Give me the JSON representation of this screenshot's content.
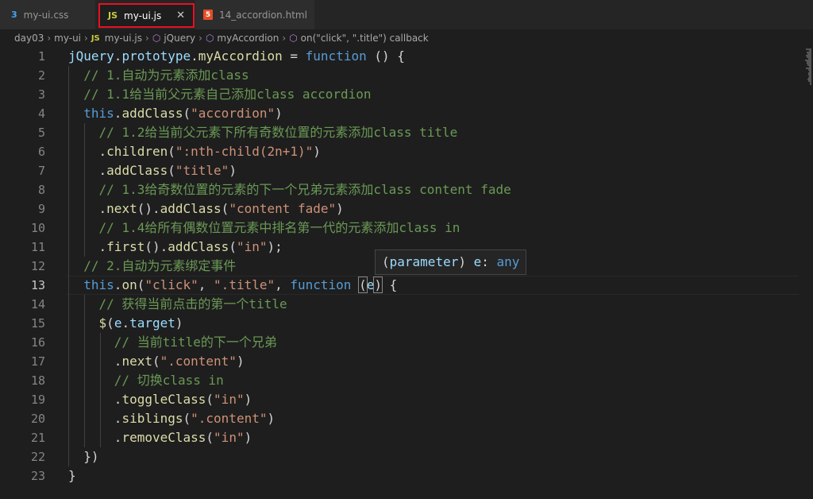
{
  "tabs": [
    {
      "label": "my-ui.css",
      "icon": "css-file-icon",
      "glyph": "3"
    },
    {
      "label": "my-ui.js",
      "icon": "js-file-icon",
      "glyph": "JS",
      "close": "✕"
    },
    {
      "label": "14_accordion.html",
      "icon": "html-file-icon",
      "glyph": "5"
    }
  ],
  "breadcrumb": [
    "day03",
    "my-ui",
    "my-ui.js",
    "jQuery",
    "myAccordion",
    "on(\"click\", \".title\") callback"
  ],
  "breadcrumb_js_glyph": "JS",
  "hover": {
    "text": "(parameter) e: any"
  },
  "current_line": 13,
  "line_numbers": [
    "1",
    "2",
    "3",
    "4",
    "5",
    "6",
    "7",
    "8",
    "9",
    "10",
    "11",
    "12",
    "13",
    "14",
    "15",
    "16",
    "17",
    "18",
    "19",
    "20",
    "21",
    "22",
    "23"
  ],
  "code_lines": [
    "jQuery.prototype.myAccordion = function () {",
    "  // 1.自动为元素添加class",
    "  // 1.1给当前父元素自己添加class accordion",
    "  this.addClass(\"accordion\")",
    "    // 1.2给当前父元素下所有奇数位置的元素添加class title",
    "    .children(\":nth-child(2n+1)\")",
    "    .addClass(\"title\")",
    "    // 1.3给奇数位置的元素的下一个兄弟元素添加class content fade",
    "    .next().addClass(\"content fade\")",
    "    // 1.4给所有偶数位置元素中排名第一代的元素添加class in",
    "    .first().addClass(\"in\");",
    "  // 2.自动为元素绑定事件",
    "  this.on(\"click\", \".title\", function (e) {",
    "    // 获得当前点击的第一个title",
    "    $(e.target)",
    "      // 当前title的下一个兄弟",
    "      .next(\".content\")",
    "      // 切换class in",
    "      .toggleClass(\"in\")",
    "      .siblings(\".content\")",
    "      .removeClass(\"in\")",
    "  })",
    "}"
  ],
  "colors": {
    "background": "#1e1e1e",
    "comment": "#6a9955",
    "string": "#ce9178",
    "keyword": "#569cd6",
    "function": "#dcdcaa",
    "variable": "#9cdcfe",
    "active_tab_border": "#e81123"
  }
}
